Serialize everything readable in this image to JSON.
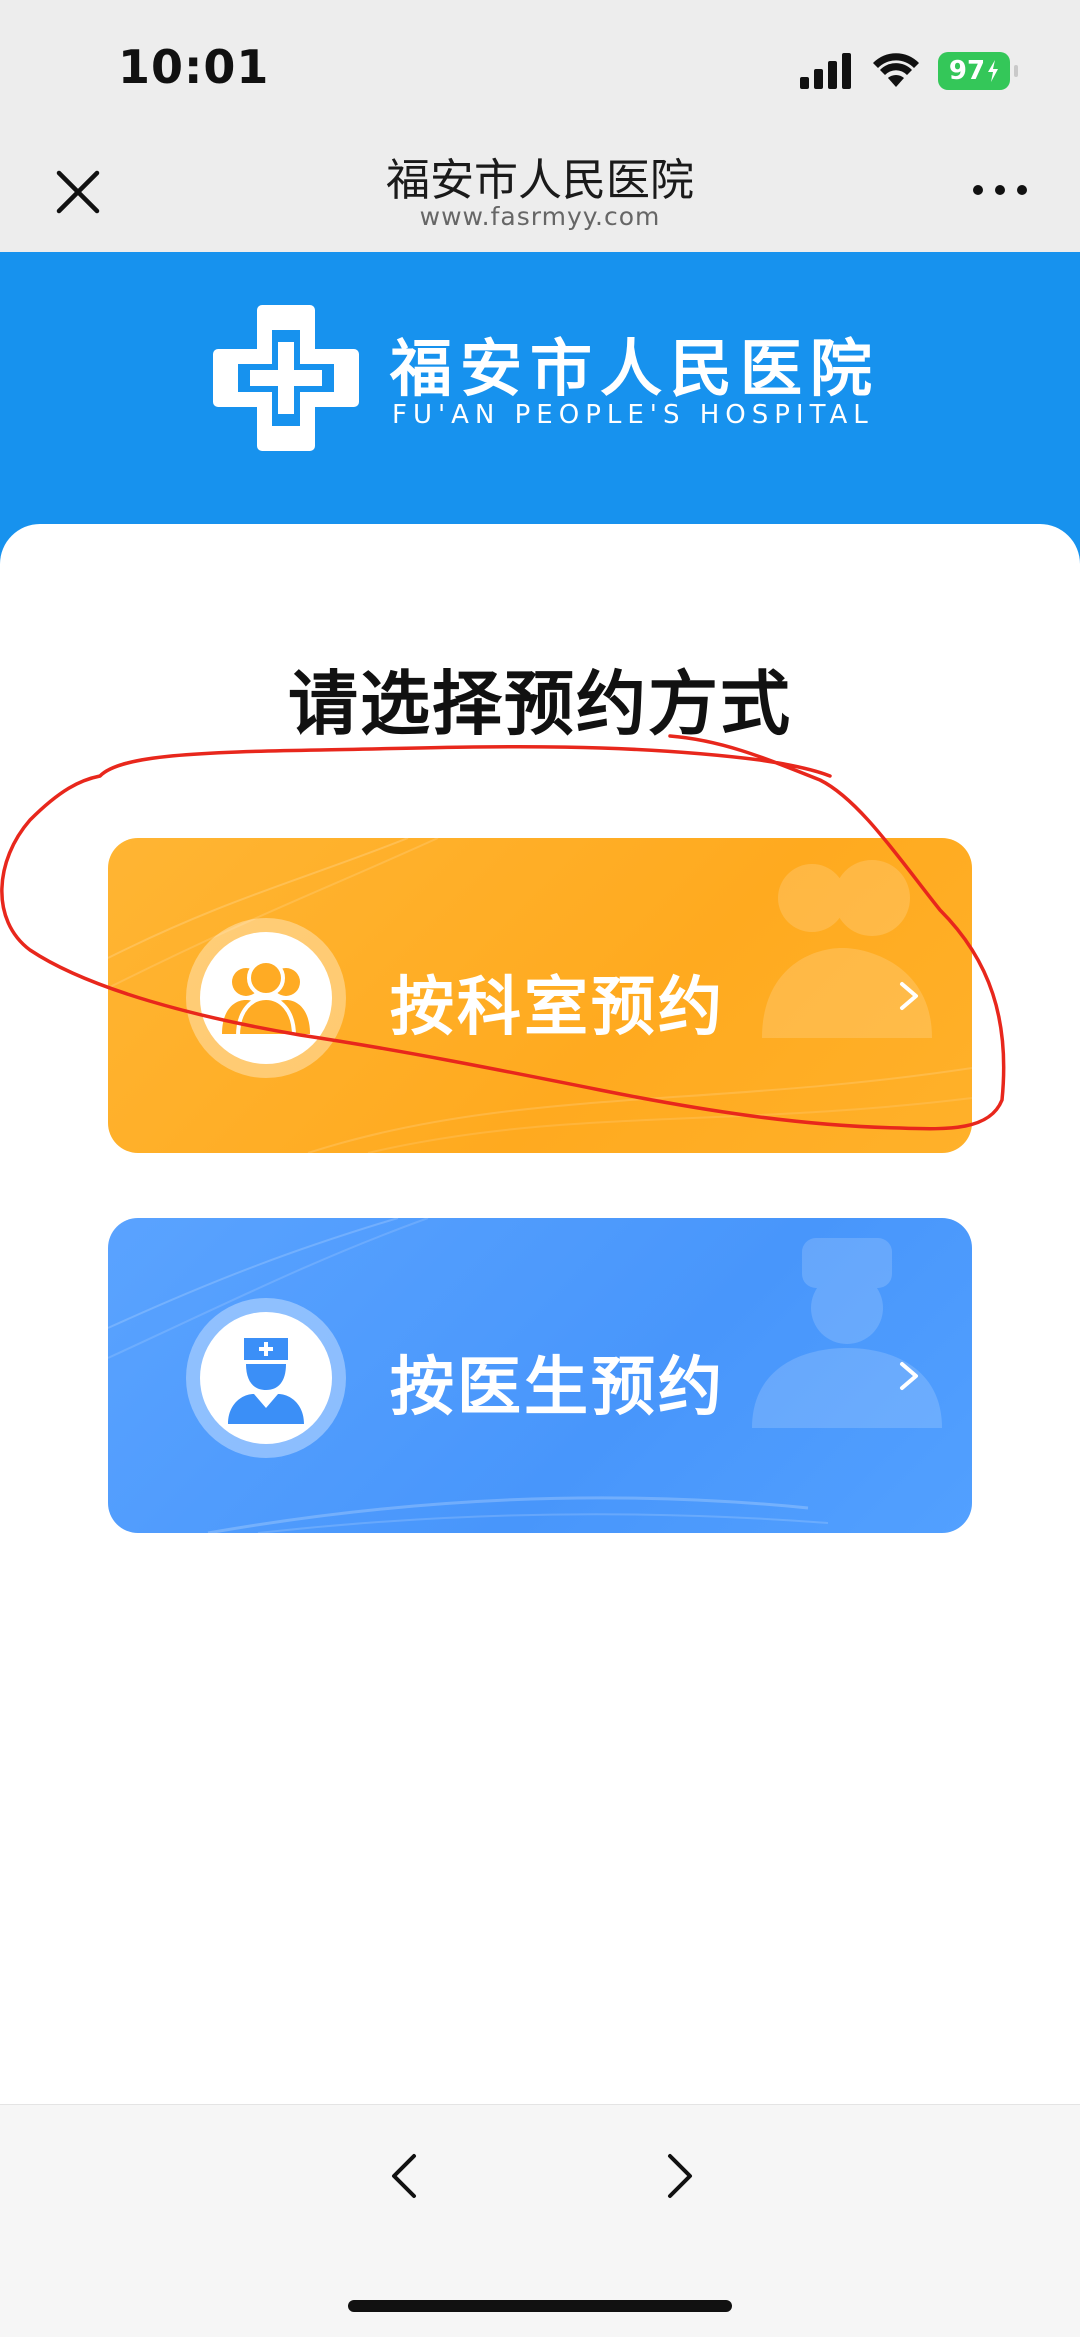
{
  "status_bar": {
    "time": "10:01",
    "battery": "97"
  },
  "nav": {
    "title": "福安市人民医院",
    "url": "www.fasrmyy.com"
  },
  "header": {
    "hospital_name": "福安市人民医院",
    "hospital_en": "FU'AN PEOPLE'S HOSPITAL"
  },
  "main": {
    "title": "请选择预约方式",
    "options": [
      {
        "label": "按科室预约"
      },
      {
        "label": "按医生预约"
      }
    ]
  },
  "icons": {
    "close": "close-icon",
    "more": "more-icon",
    "logo": "hospital-cross-logo",
    "dept": "group-icon",
    "doctor": "doctor-icon",
    "chevron": "chevron-right-icon",
    "back": "back-icon",
    "forward": "forward-icon"
  },
  "colors": {
    "header_blue": "#1792ee",
    "dept_orange": "#ffaa1f",
    "doctor_blue": "#4896fb",
    "annotation_red": "#e8271c",
    "battery_green": "#34c759"
  }
}
